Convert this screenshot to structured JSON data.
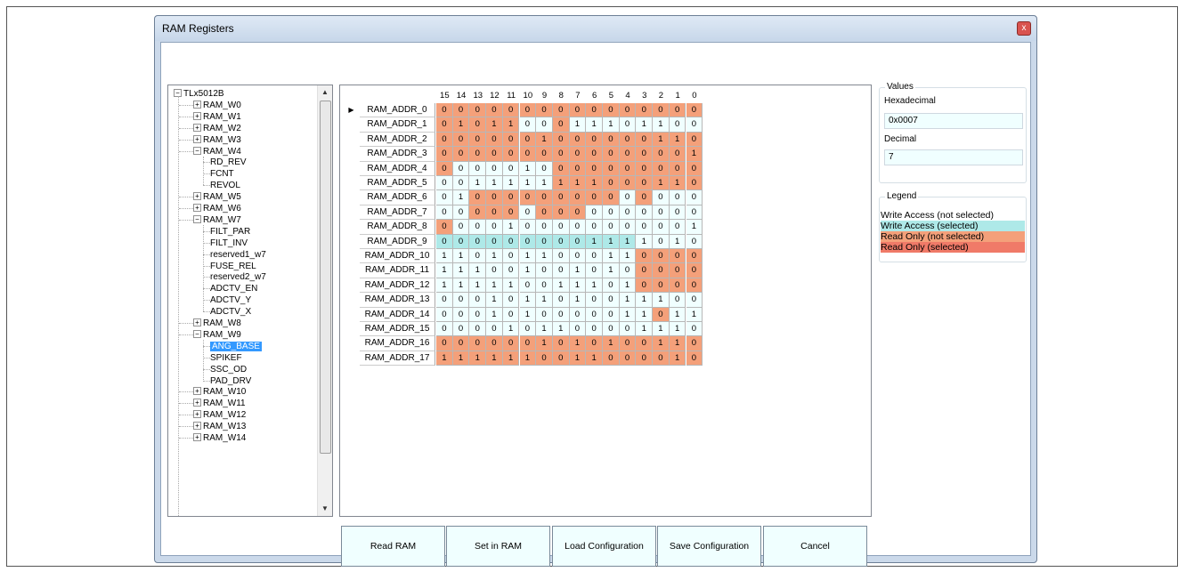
{
  "window": {
    "title": "RAM Registers",
    "close_glyph": "x"
  },
  "tree": {
    "root": "TLx5012B",
    "items": [
      {
        "label": "RAM_W0",
        "type": "collapsed"
      },
      {
        "label": "RAM_W1",
        "type": "collapsed"
      },
      {
        "label": "RAM_W2",
        "type": "collapsed"
      },
      {
        "label": "RAM_W3",
        "type": "collapsed"
      },
      {
        "label": "RAM_W4",
        "type": "expanded"
      },
      {
        "label": "RD_REV",
        "type": "child"
      },
      {
        "label": "FCNT",
        "type": "child"
      },
      {
        "label": "REVOL",
        "type": "child"
      },
      {
        "label": "RAM_W5",
        "type": "collapsed"
      },
      {
        "label": "RAM_W6",
        "type": "collapsed"
      },
      {
        "label": "RAM_W7",
        "type": "expanded"
      },
      {
        "label": "FILT_PAR",
        "type": "child"
      },
      {
        "label": "FILT_INV",
        "type": "child"
      },
      {
        "label": "reserved1_w7",
        "type": "child"
      },
      {
        "label": "FUSE_REL",
        "type": "child"
      },
      {
        "label": "reserved2_w7",
        "type": "child"
      },
      {
        "label": "ADCTV_EN",
        "type": "child"
      },
      {
        "label": "ADCTV_Y",
        "type": "child"
      },
      {
        "label": "ADCTV_X",
        "type": "child"
      },
      {
        "label": "RAM_W8",
        "type": "collapsed"
      },
      {
        "label": "RAM_W9",
        "type": "expanded"
      },
      {
        "label": "ANG_BASE",
        "type": "child",
        "selected": true
      },
      {
        "label": "SPIKEF",
        "type": "child"
      },
      {
        "label": "SSC_OD",
        "type": "child"
      },
      {
        "label": "PAD_DRV",
        "type": "child"
      },
      {
        "label": "RAM_W10",
        "type": "collapsed"
      },
      {
        "label": "RAM_W11",
        "type": "collapsed"
      },
      {
        "label": "RAM_W12",
        "type": "collapsed"
      },
      {
        "label": "RAM_W13",
        "type": "collapsed"
      },
      {
        "label": "RAM_W14",
        "type": "collapsed"
      }
    ]
  },
  "grid": {
    "columns": [
      "15",
      "14",
      "13",
      "12",
      "11",
      "10",
      "9",
      "8",
      "7",
      "6",
      "5",
      "4",
      "3",
      "2",
      "1",
      "0"
    ],
    "current_row_marker": "▶",
    "legend_codes": {
      "w": "write access (not selected)",
      "W": "write access (selected)",
      "r": "read only (not selected)",
      "R": "read only (selected)"
    },
    "rows": [
      {
        "name": "RAM_ADDR_0",
        "bits": [
          "0",
          "0",
          "0",
          "0",
          "0",
          "0",
          "0",
          "0",
          "0",
          "0",
          "0",
          "0",
          "0",
          "0",
          "0",
          "0"
        ],
        "types": "rrrrrrrrrrrrrrrr"
      },
      {
        "name": "RAM_ADDR_1",
        "bits": [
          "0",
          "1",
          "0",
          "1",
          "1",
          "0",
          "0",
          "0",
          "1",
          "1",
          "1",
          "0",
          "1",
          "1",
          "0",
          "0"
        ],
        "types": "rrrrrwwrwwwwwwww"
      },
      {
        "name": "RAM_ADDR_2",
        "bits": [
          "0",
          "0",
          "0",
          "0",
          "0",
          "0",
          "1",
          "0",
          "0",
          "0",
          "0",
          "0",
          "0",
          "1",
          "1",
          "0"
        ],
        "types": "rrrrrrrrrrrrrrrr"
      },
      {
        "name": "RAM_ADDR_3",
        "bits": [
          "0",
          "0",
          "0",
          "0",
          "0",
          "0",
          "0",
          "0",
          "0",
          "0",
          "0",
          "0",
          "0",
          "0",
          "0",
          "1"
        ],
        "types": "rrrrrrrrrrrrrrrr"
      },
      {
        "name": "RAM_ADDR_4",
        "bits": [
          "0",
          "0",
          "0",
          "0",
          "0",
          "1",
          "0",
          "0",
          "0",
          "0",
          "0",
          "0",
          "0",
          "0",
          "0",
          "0"
        ],
        "types": "rwwwwwwrrrrrrrrr"
      },
      {
        "name": "RAM_ADDR_5",
        "bits": [
          "0",
          "0",
          "1",
          "1",
          "1",
          "1",
          "1",
          "1",
          "1",
          "1",
          "0",
          "0",
          "0",
          "1",
          "1",
          "0"
        ],
        "types": "wwwwwwwrrrrrrrrr"
      },
      {
        "name": "RAM_ADDR_6",
        "bits": [
          "0",
          "1",
          "0",
          "0",
          "0",
          "0",
          "0",
          "0",
          "0",
          "0",
          "0",
          "0",
          "0",
          "0",
          "0",
          "0"
        ],
        "types": "wwrrrrrrrrrwrwww"
      },
      {
        "name": "RAM_ADDR_7",
        "bits": [
          "0",
          "0",
          "0",
          "0",
          "0",
          "0",
          "0",
          "0",
          "0",
          "0",
          "0",
          "0",
          "0",
          "0",
          "0",
          "0"
        ],
        "types": "wwrrrwrrrwwwwwww"
      },
      {
        "name": "RAM_ADDR_8",
        "bits": [
          "0",
          "0",
          "0",
          "0",
          "1",
          "0",
          "0",
          "0",
          "0",
          "0",
          "0",
          "0",
          "0",
          "0",
          "0",
          "1"
        ],
        "types": "rwwwwwwwwwwwwwww"
      },
      {
        "name": "RAM_ADDR_9",
        "bits": [
          "0",
          "0",
          "0",
          "0",
          "0",
          "0",
          "0",
          "0",
          "0",
          "1",
          "1",
          "1",
          "1",
          "0",
          "1",
          "0"
        ],
        "types": "WWWWWWWWWWWWwwww"
      },
      {
        "name": "RAM_ADDR_10",
        "bits": [
          "1",
          "1",
          "0",
          "1",
          "0",
          "1",
          "1",
          "0",
          "0",
          "0",
          "1",
          "1",
          "0",
          "0",
          "0",
          "0"
        ],
        "types": "wwwwwwwwwwwwrrrr"
      },
      {
        "name": "RAM_ADDR_11",
        "bits": [
          "1",
          "1",
          "1",
          "0",
          "0",
          "1",
          "0",
          "0",
          "1",
          "0",
          "1",
          "0",
          "0",
          "0",
          "0",
          "0"
        ],
        "types": "wwwwwwwwwwwwrrrr"
      },
      {
        "name": "RAM_ADDR_12",
        "bits": [
          "1",
          "1",
          "1",
          "1",
          "1",
          "0",
          "0",
          "1",
          "1",
          "1",
          "0",
          "1",
          "0",
          "0",
          "0",
          "0"
        ],
        "types": "wwwwwwwwwwwwrrrr"
      },
      {
        "name": "RAM_ADDR_13",
        "bits": [
          "0",
          "0",
          "0",
          "1",
          "0",
          "1",
          "1",
          "0",
          "1",
          "0",
          "0",
          "1",
          "1",
          "1",
          "0",
          "0"
        ],
        "types": "wwwwwwwwwwwwwwww"
      },
      {
        "name": "RAM_ADDR_14",
        "bits": [
          "0",
          "0",
          "0",
          "1",
          "0",
          "1",
          "0",
          "0",
          "0",
          "0",
          "0",
          "1",
          "1",
          "0",
          "1",
          "1"
        ],
        "types": "wwwwwwwwwwwwwrww"
      },
      {
        "name": "RAM_ADDR_15",
        "bits": [
          "0",
          "0",
          "0",
          "0",
          "1",
          "0",
          "1",
          "1",
          "0",
          "0",
          "0",
          "0",
          "1",
          "1",
          "1",
          "0"
        ],
        "types": "wwwwwwwwwwwwwwww"
      },
      {
        "name": "RAM_ADDR_16",
        "bits": [
          "0",
          "0",
          "0",
          "0",
          "0",
          "0",
          "1",
          "0",
          "1",
          "0",
          "1",
          "0",
          "0",
          "1",
          "1",
          "0"
        ],
        "types": "rrrrrrrrrrrrrrrr"
      },
      {
        "name": "RAM_ADDR_17",
        "bits": [
          "1",
          "1",
          "1",
          "1",
          "1",
          "1",
          "0",
          "0",
          "1",
          "1",
          "0",
          "0",
          "0",
          "0",
          "1",
          "0"
        ],
        "types": "rrrrrrrrrrrrrrrr"
      }
    ]
  },
  "values": {
    "title": "Values",
    "hex_label": "Hexadecimal",
    "hex_value": "0x0007",
    "dec_label": "Decimal",
    "dec_value": "7"
  },
  "legend": {
    "title": "Legend",
    "items": [
      {
        "label": "Write Access (not selected)",
        "color": "#ffffff"
      },
      {
        "label": "Write Access (selected)",
        "color": "#aee9e8"
      },
      {
        "label": "Read Only (not selected)",
        "color": "#f4a07a"
      },
      {
        "label": "Read Only (selected)",
        "color": "#f07a68"
      }
    ]
  },
  "buttons": {
    "read_ram": "Read RAM",
    "set_in_ram": "Set in RAM",
    "load_config": "Load Configuration",
    "save_config": "Save Configuration",
    "cancel": "Cancel"
  },
  "colors": {
    "write": "#f0ffff",
    "write_selected": "#aee9e8",
    "read": "#f4a07a",
    "read_selected": "#f07a68"
  }
}
